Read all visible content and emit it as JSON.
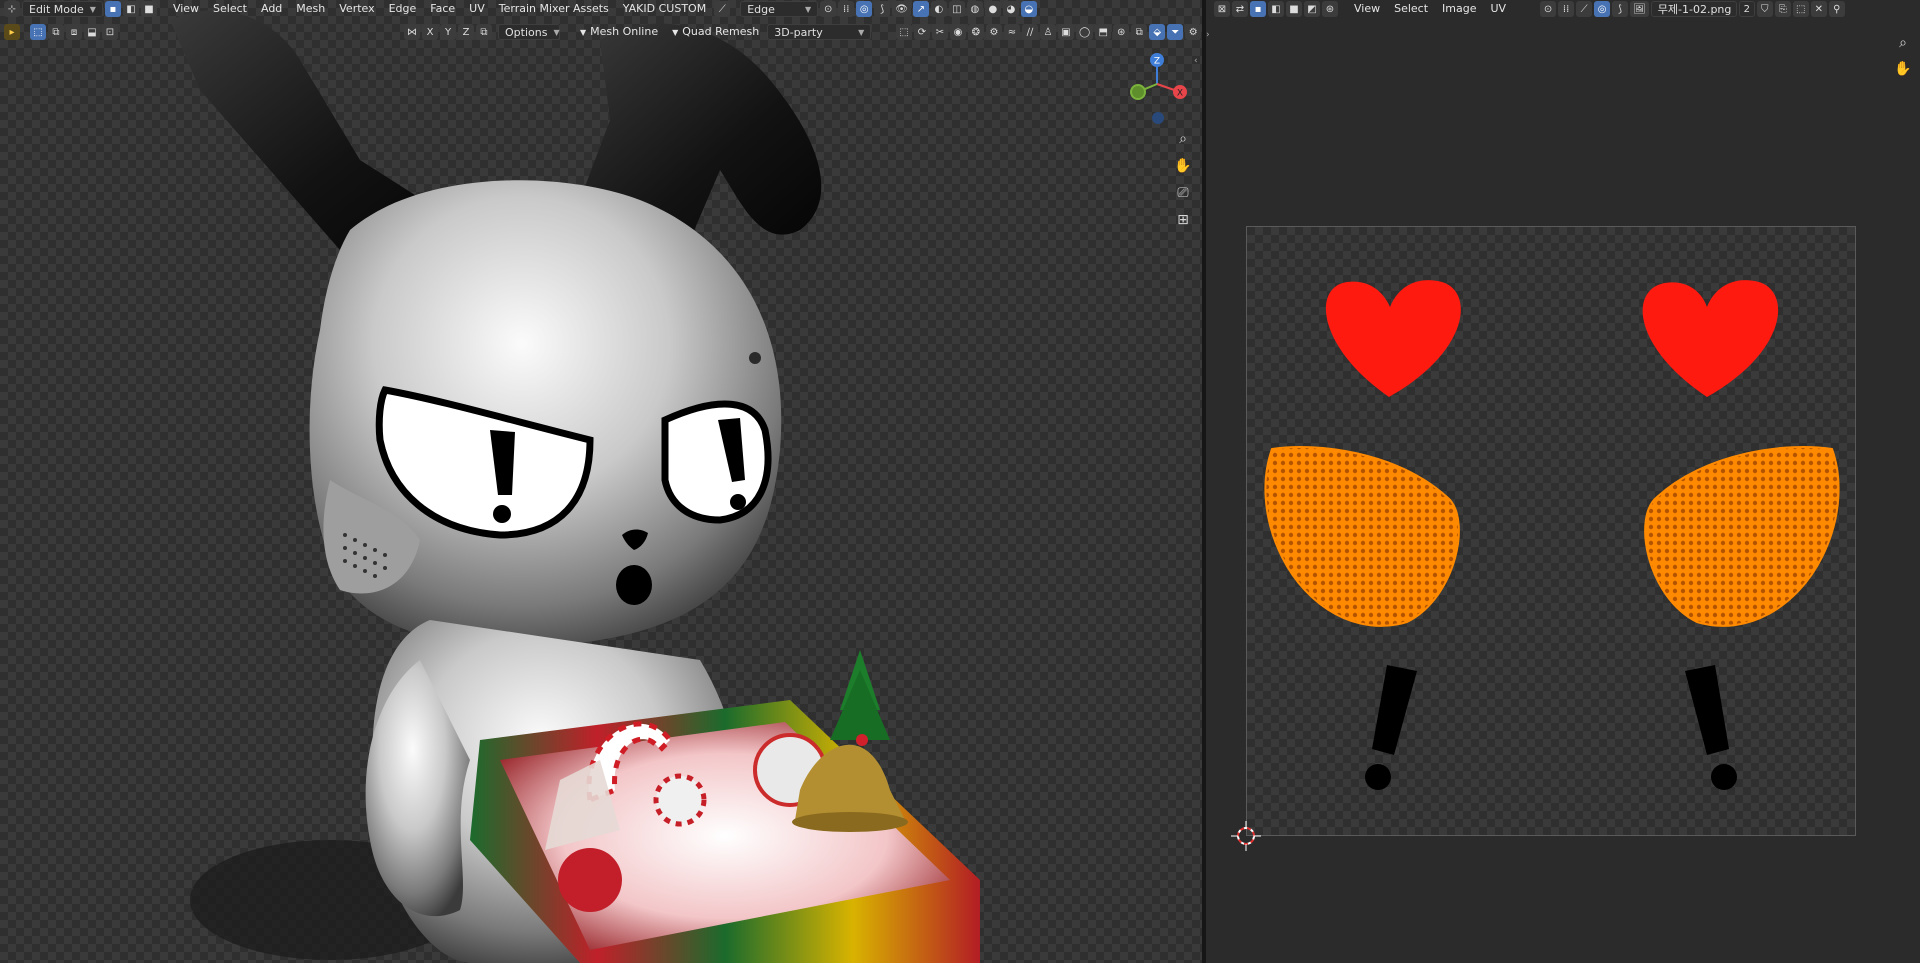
{
  "viewport3d": {
    "mode": "Edit Mode",
    "menus": [
      "View",
      "Select",
      "Add",
      "Mesh",
      "Vertex",
      "Edge",
      "Face",
      "UV",
      "Terrain Mixer Assets",
      "YAKID CUSTOM"
    ],
    "select_mode_dropdown": "Edge",
    "toolbar2": {
      "axes": [
        "X",
        "Y",
        "Z"
      ],
      "options_label": "Options",
      "addon_1": "Mesh Online",
      "addon_2": "Quad Remesh",
      "addon_3": "3D-party"
    },
    "gizmo_axes": {
      "z": "Z",
      "x": "X",
      "y": "Y"
    }
  },
  "uv_editor": {
    "menus": [
      "View",
      "Select",
      "Image",
      "UV"
    ],
    "image_name": "무제-1-02.png",
    "user_count": "2"
  },
  "colors": {
    "accent": "#4772b3",
    "heart_red": "#ff1a10",
    "uv_orange": "#ff8a00",
    "gizmo_x": "#e8454a",
    "gizmo_y": "#7bb33c",
    "gizmo_z": "#3f7ed8"
  },
  "icons": [
    "cursor-icon",
    "zoom-icon",
    "hand-icon",
    "camera-icon",
    "grid-icon",
    "close-icon",
    "pin-icon"
  ]
}
